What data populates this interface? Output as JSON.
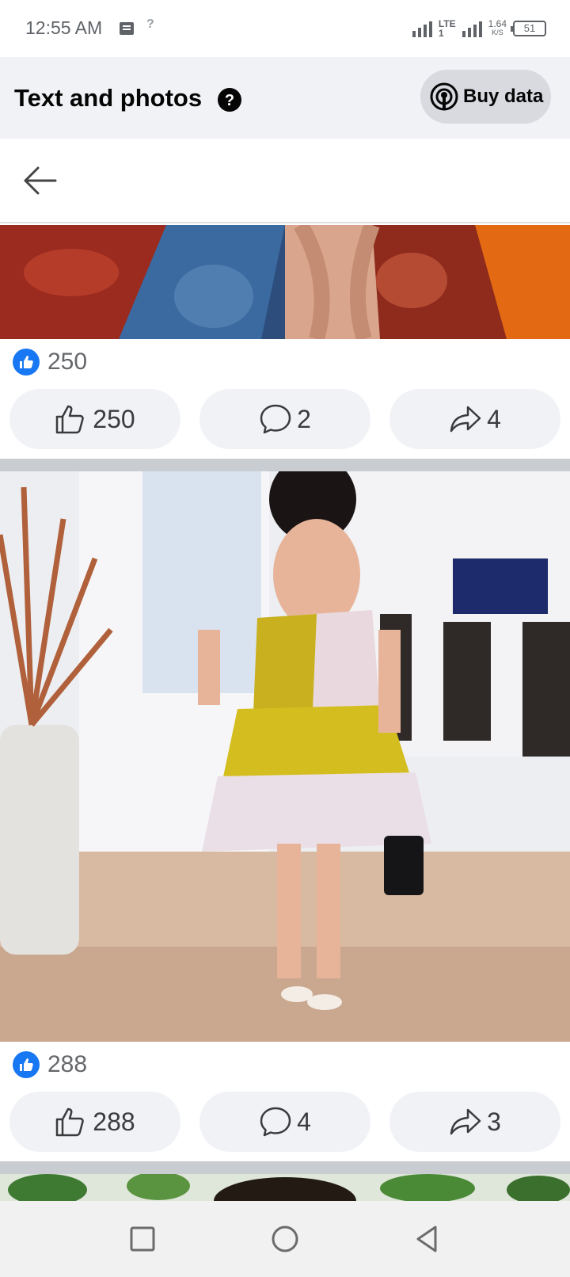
{
  "status_bar": {
    "time": "12:55 AM",
    "no_sim": "?",
    "network": "LTE",
    "network_sub": "1",
    "speed_value": "1.64",
    "speed_unit": "K/S",
    "battery": "51"
  },
  "header": {
    "title": "Text and photos",
    "help_icon": "question-circle-icon",
    "buy_data_label": "Buy data",
    "buy_data_icon": "broadcast-icon"
  },
  "back_bar": {
    "icon": "arrow-left-icon"
  },
  "posts": [
    {
      "likes_summary": "250",
      "actions": {
        "like": "250",
        "comment": "2",
        "share": "4"
      }
    },
    {
      "likes_summary": "288",
      "actions": {
        "like": "288",
        "comment": "4",
        "share": "3"
      }
    }
  ],
  "nav_bar": {
    "recents_icon": "square-icon",
    "home_icon": "circle-icon",
    "back_icon": "triangle-back-icon"
  },
  "colors": {
    "accent": "#1877f2",
    "header_bg": "#f0f2f5",
    "button_bg": "#f0f2f5",
    "divider": "#c9ccd1"
  }
}
